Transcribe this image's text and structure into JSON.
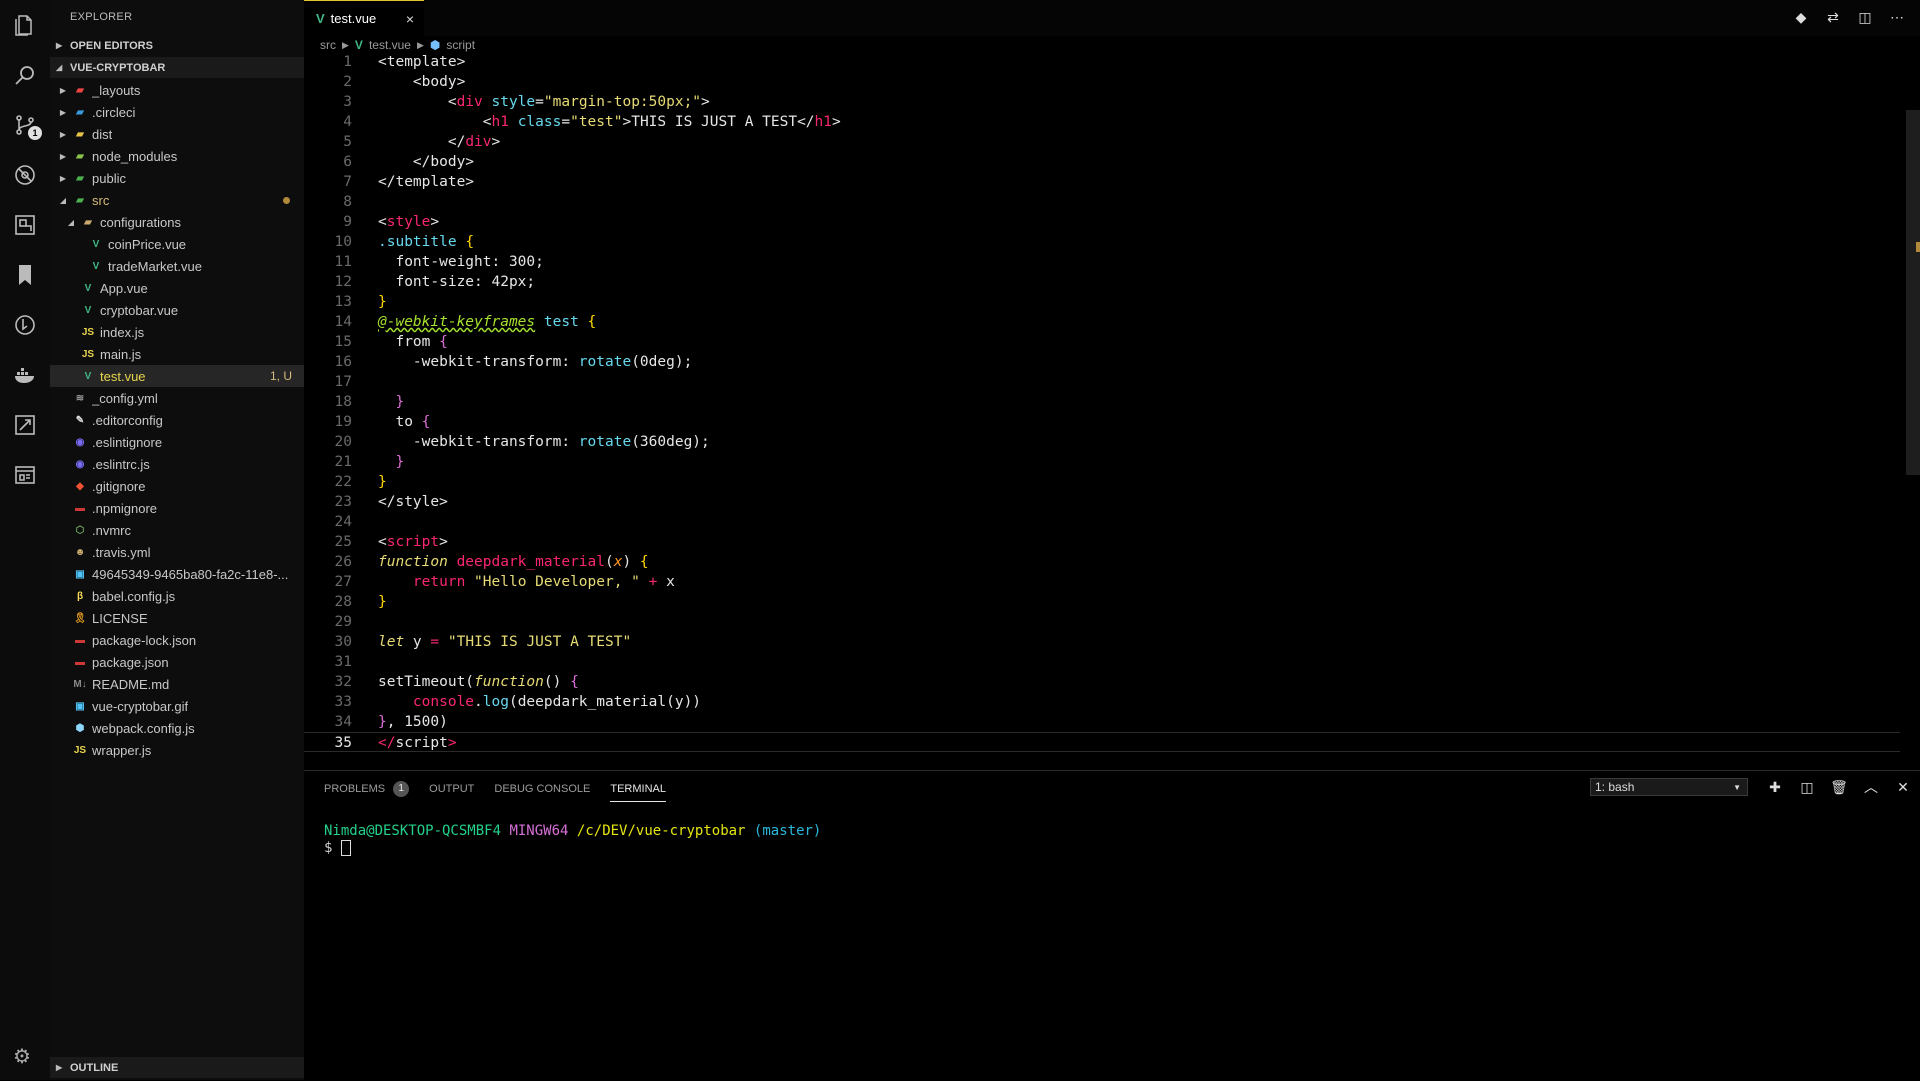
{
  "activity_bar": {
    "icons": [
      "files-icon",
      "search-icon",
      "source-control-icon",
      "debug-icon",
      "extensions-icon",
      "bookmark-icon",
      "git-history-icon",
      "docker-icon",
      "remote-icon",
      "browser-preview-icon"
    ],
    "scm_badge": "1",
    "settings_icon": "gear-icon"
  },
  "sidebar": {
    "title": "EXPLORER",
    "open_editors_label": "OPEN EDITORS",
    "project_label": "VUE-CRYPTOBAR",
    "outline_label": "OUTLINE",
    "tree": [
      {
        "name": "_layouts",
        "indent": 1,
        "caret": "▶",
        "icon": "folder",
        "color": "#e44"
      },
      {
        "name": ".circleci",
        "indent": 1,
        "caret": "▶",
        "icon": "folder",
        "color": "#3a9ad9"
      },
      {
        "name": "dist",
        "indent": 1,
        "caret": "▶",
        "icon": "folder",
        "color": "#e8c547"
      },
      {
        "name": "node_modules",
        "indent": 1,
        "caret": "▶",
        "icon": "folder",
        "color": "#8bc34a"
      },
      {
        "name": "public",
        "indent": 1,
        "caret": "▶",
        "icon": "folder",
        "color": "#4caf50"
      },
      {
        "name": "src",
        "indent": 1,
        "caret": "◢",
        "icon": "folder",
        "color": "#4caf50",
        "dirty": true,
        "dot": true
      },
      {
        "name": "configurations",
        "indent": 2,
        "caret": "◢",
        "icon": "folder",
        "color": "#c9a96e"
      },
      {
        "name": "coinPrice.vue",
        "indent": 3,
        "icon": "vue",
        "color": "#41b883"
      },
      {
        "name": "tradeMarket.vue",
        "indent": 3,
        "icon": "vue",
        "color": "#41b883"
      },
      {
        "name": "App.vue",
        "indent": 2,
        "icon": "vue",
        "color": "#41b883"
      },
      {
        "name": "cryptobar.vue",
        "indent": 2,
        "icon": "vue",
        "color": "#41b883"
      },
      {
        "name": "index.js",
        "indent": 2,
        "icon": "js",
        "color": "#e8d44d"
      },
      {
        "name": "main.js",
        "indent": 2,
        "icon": "js",
        "color": "#e8d44d"
      },
      {
        "name": "test.vue",
        "indent": 2,
        "icon": "vue",
        "color": "#41b883",
        "selected": true,
        "status": "1, U"
      },
      {
        "name": "_config.yml",
        "indent": 1,
        "icon": "yml",
        "color": "#999"
      },
      {
        "name": ".editorconfig",
        "indent": 1,
        "icon": "editorconfig",
        "color": "#ddd"
      },
      {
        "name": ".eslintignore",
        "indent": 1,
        "icon": "eslint",
        "color": "#7b6cf6"
      },
      {
        "name": ".eslintrc.js",
        "indent": 1,
        "icon": "eslint",
        "color": "#7b6cf6"
      },
      {
        "name": ".gitignore",
        "indent": 1,
        "icon": "git",
        "color": "#f05133"
      },
      {
        "name": ".npmignore",
        "indent": 1,
        "icon": "npm",
        "color": "#cb3837"
      },
      {
        "name": ".nvmrc",
        "indent": 1,
        "icon": "node",
        "color": "#6da55f"
      },
      {
        "name": ".travis.yml",
        "indent": 1,
        "icon": "travis",
        "color": "#c9a96e"
      },
      {
        "name": "49645349-9465ba80-fa2c-11e8-...",
        "indent": 1,
        "icon": "image",
        "color": "#4fc3f7"
      },
      {
        "name": "babel.config.js",
        "indent": 1,
        "icon": "babel",
        "color": "#f5da55"
      },
      {
        "name": "LICENSE",
        "indent": 1,
        "icon": "license",
        "color": "#f5a623"
      },
      {
        "name": "package-lock.json",
        "indent": 1,
        "icon": "npm",
        "color": "#cb3837"
      },
      {
        "name": "package.json",
        "indent": 1,
        "icon": "npm",
        "color": "#cb3837"
      },
      {
        "name": "README.md",
        "indent": 1,
        "icon": "md",
        "color": "#888"
      },
      {
        "name": "vue-cryptobar.gif",
        "indent": 1,
        "icon": "image",
        "color": "#4fc3f7"
      },
      {
        "name": "webpack.config.js",
        "indent": 1,
        "icon": "webpack",
        "color": "#8ed6fb"
      },
      {
        "name": "wrapper.js",
        "indent": 1,
        "icon": "js",
        "color": "#e8d44d"
      }
    ]
  },
  "editor": {
    "tab_label": "test.vue",
    "tab_close": "×",
    "breadcrumb": {
      "folder": "src",
      "file": "test.vue",
      "symbol": "script"
    },
    "actions": [
      "git-compare-icon",
      "open-changes-icon",
      "split-editor-icon",
      "more-actions-icon"
    ],
    "current_line": "35",
    "lines": [
      {
        "n": "1",
        "html": "&lt;template&gt;"
      },
      {
        "n": "2",
        "html": "    <span class='t-punc'>&lt;</span><span class='t-punc'>body</span><span class='t-punc'>&gt;</span>"
      },
      {
        "n": "3",
        "html": "        <span class='t-punc'>&lt;</span><span class='t-tag'>div</span> <span class='t-attr'>style</span>=<span class='t-str'>\"margin-top:50px;\"</span>&gt;"
      },
      {
        "n": "4",
        "html": "            &lt;<span class='t-tag'>h1</span> <span class='t-attr'>class</span>=<span class='t-str'>\"test\"</span>&gt;THIS IS JUST A TEST&lt;/<span class='t-tag'>h1</span>&gt;"
      },
      {
        "n": "5",
        "html": "        &lt;/<span class='t-tag'>div</span>&gt;"
      },
      {
        "n": "6",
        "html": "    &lt;/body&gt;"
      },
      {
        "n": "7",
        "html": "&lt;/template&gt;"
      },
      {
        "n": "8",
        "html": ""
      },
      {
        "n": "9",
        "html": "&lt;<span class='t-tag'>style</span>&gt;"
      },
      {
        "n": "10",
        "html": "<span class='t-sel'>.subtitle</span> <span class='t-brace'>{</span>"
      },
      {
        "n": "11",
        "html": "  font-weight: 300;"
      },
      {
        "n": "12",
        "html": "  font-size: 42px;"
      },
      {
        "n": "13",
        "html": "<span class='t-brace'>}</span>"
      },
      {
        "n": "14",
        "html": "<span class='t-at'>@-webkit-keyframes</span> <span class='t-sel'>test</span> <span class='t-brace'>{</span>"
      },
      {
        "n": "15",
        "html": "  from <span class='t-brace2'>{</span>"
      },
      {
        "n": "16",
        "html": "    -webkit-transform: <span class='t-fnc'>rotate</span>(0deg);"
      },
      {
        "n": "17",
        "html": ""
      },
      {
        "n": "18",
        "html": "  <span class='t-brace2'>}</span>"
      },
      {
        "n": "19",
        "html": "  to <span class='t-brace2'>{</span>"
      },
      {
        "n": "20",
        "html": "    -webkit-transform: <span class='t-fnc'>rotate</span>(360deg);"
      },
      {
        "n": "21",
        "html": "  <span class='t-brace2'>}</span>"
      },
      {
        "n": "22",
        "html": "<span class='t-brace'>}</span>"
      },
      {
        "n": "23",
        "html": "&lt;/style&gt;"
      },
      {
        "n": "24",
        "html": ""
      },
      {
        "n": "25",
        "html": "&lt;<span class='t-tag'>script</span>&gt;"
      },
      {
        "n": "26",
        "html": "<span class='t-kw-i'>function</span> <span class='t-fn'>deepdark_material</span>(<span class='t-param'>x</span>) <span class='t-brace'>{</span>"
      },
      {
        "n": "27",
        "html": "    <span class='t-fn'>return</span> <span class='t-str'>\"Hello Developer, \"</span> <span class='t-op'>+</span> x"
      },
      {
        "n": "28",
        "html": "<span class='t-brace'>}</span>"
      },
      {
        "n": "29",
        "html": ""
      },
      {
        "n": "30",
        "html": "<span class='t-kw-i'>let</span> y <span class='t-op'>=</span> <span class='t-str'>\"THIS IS JUST A TEST\"</span>"
      },
      {
        "n": "31",
        "html": ""
      },
      {
        "n": "32",
        "html": "setTimeout(<span class='t-kw-i'>function</span>() <span class='t-brace2'>{</span>"
      },
      {
        "n": "33",
        "html": "    <span class='t-fn'>console</span>.<span class='t-fnc'>log</span>(deepdark_material(y))"
      },
      {
        "n": "34",
        "html": "<span class='t-brace2'>}</span>, 1500)"
      },
      {
        "n": "35",
        "html": "<span class='t-tag'>&lt;/</span>script<span class='t-tag'>&gt;</span>"
      }
    ]
  },
  "panel": {
    "tabs": [
      {
        "label": "PROBLEMS",
        "badge": "1"
      },
      {
        "label": "OUTPUT"
      },
      {
        "label": "DEBUG CONSOLE"
      },
      {
        "label": "TERMINAL",
        "active": true
      }
    ],
    "terminal_select": "1: bash",
    "actions": [
      "plus-icon",
      "split-terminal-icon",
      "trash-icon",
      "maximize-panel-icon",
      "close-panel-icon"
    ],
    "terminal": {
      "user_host": "Nimda@DESKTOP-QCSMBF4",
      "system": "MINGW64",
      "path": "/c/DEV/vue-cryptobar",
      "branch": "(master)",
      "prompt": "$"
    }
  }
}
